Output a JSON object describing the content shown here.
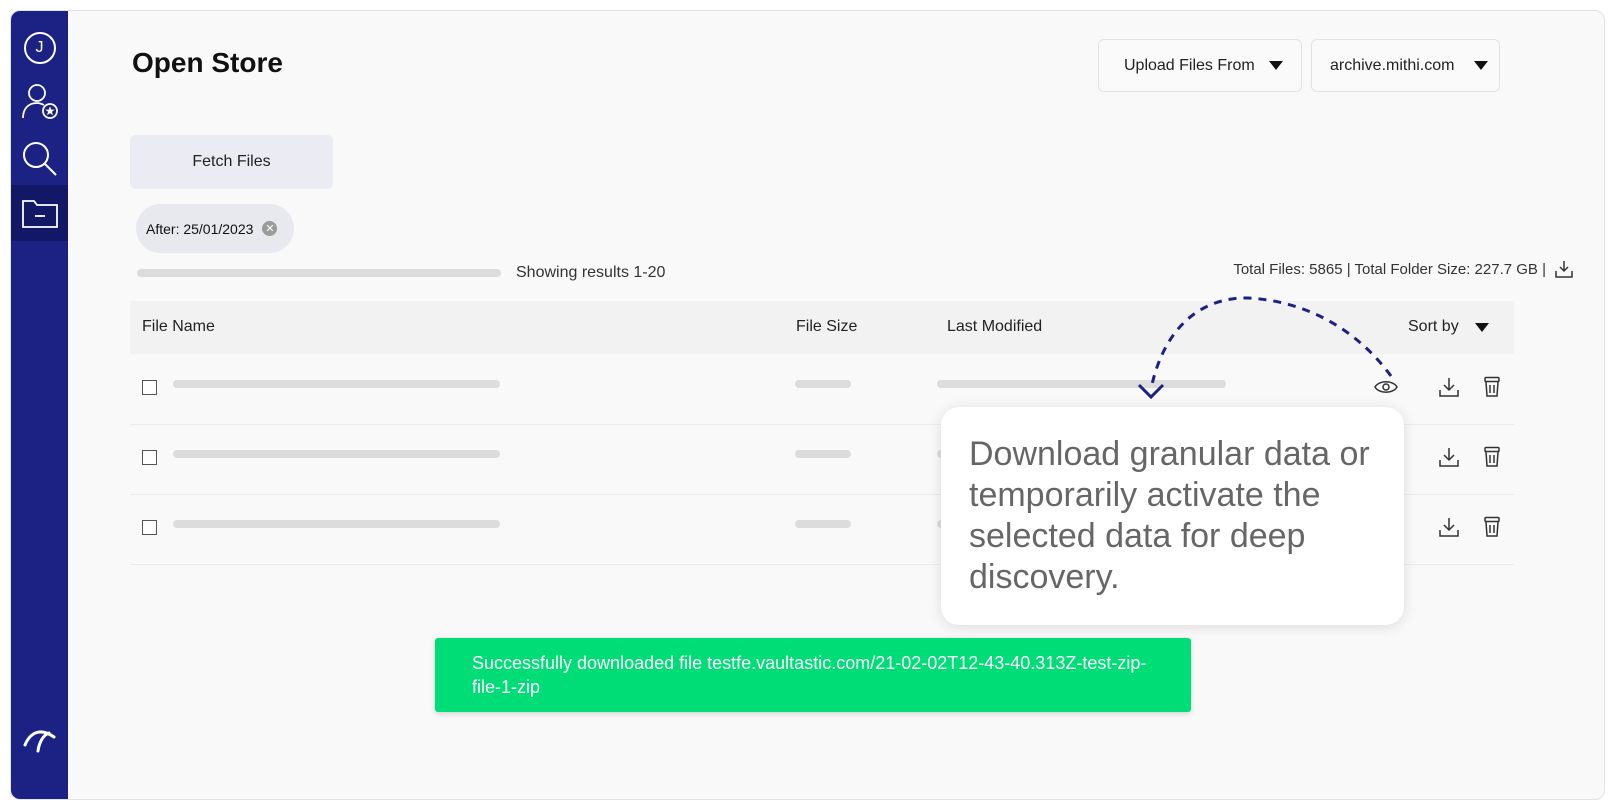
{
  "sidebar": {
    "avatar_initial": "J",
    "items": [
      {
        "icon": "user-badge-icon"
      },
      {
        "icon": "search-icon"
      },
      {
        "icon": "folder-icon",
        "active": true
      }
    ],
    "logo_icon": "mithi-logo-icon",
    "colors": {
      "background": "#1b2284",
      "active": "#121866"
    }
  },
  "header": {
    "title": "Open Store",
    "upload_dropdown": "Upload Files From",
    "domain_dropdown": "archive.mithi.com"
  },
  "toolbar": {
    "fetch_button": "Fetch Files",
    "filter_chip": "After: 25/01/2023",
    "results_text": "Showing results 1-20",
    "totals_text": "Total Files: 5865 | Total Folder Size: 227.7 GB |"
  },
  "table": {
    "columns": {
      "file_name": "File Name",
      "file_size": "File Size",
      "last_modified": "Last Modified",
      "sort_by": "Sort by"
    },
    "rows": [
      {
        "actions": [
          "eye-icon",
          "download-icon",
          "trash-icon"
        ]
      },
      {
        "actions": [
          "download-icon",
          "trash-icon"
        ]
      },
      {
        "actions": [
          "download-icon",
          "trash-icon"
        ]
      }
    ]
  },
  "tooltip": {
    "text": "Download granular data or temporarily activate the selected data for deep discovery."
  },
  "toast": {
    "message": "Successfully downloaded file testfe.vaultastic.com/21-02-02T12-43-40.313Z-test-zip-file-1-zip",
    "color": "#00dd77"
  }
}
